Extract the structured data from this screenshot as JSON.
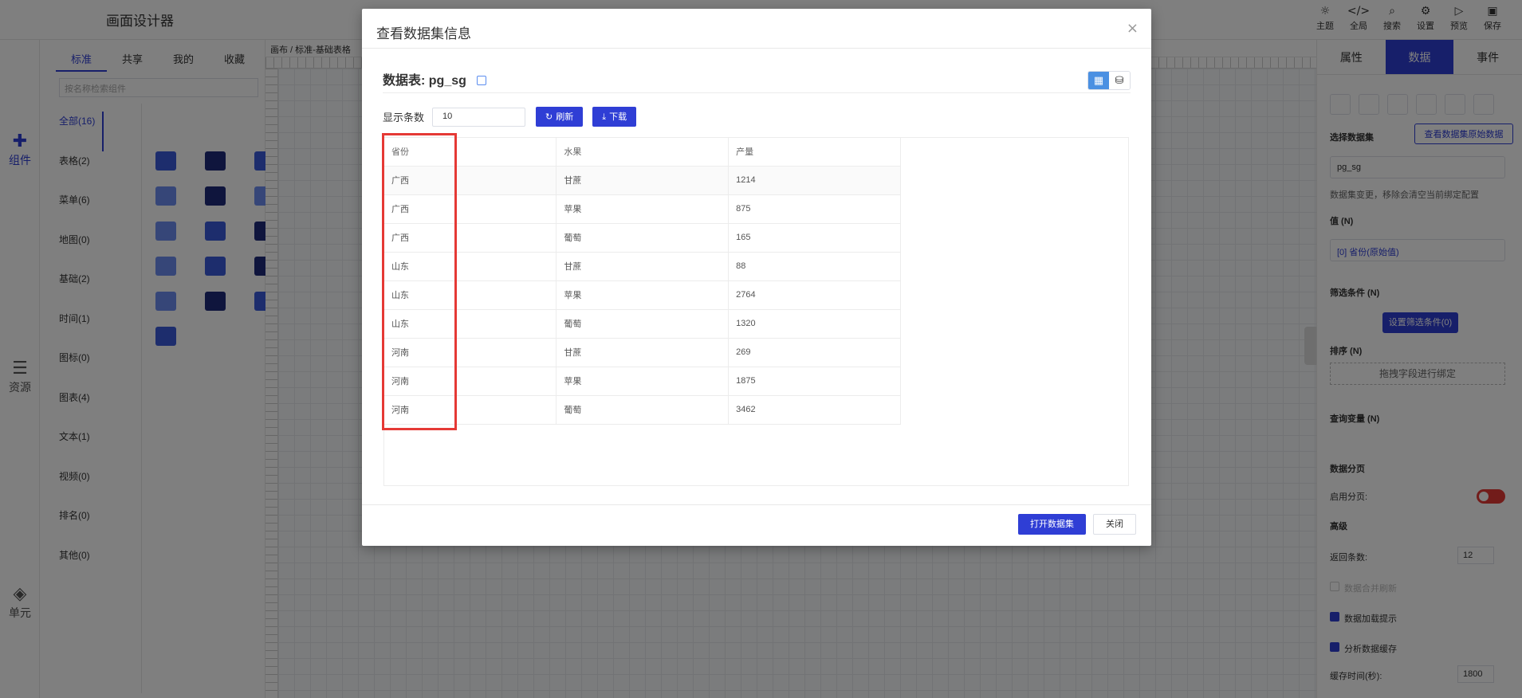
{
  "app": {
    "title": "画面设计器",
    "top_actions": [
      {
        "icon": "theme-icon",
        "glyph": "☼",
        "label": "主题"
      },
      {
        "icon": "code-icon",
        "glyph": "</>",
        "label": "全局"
      },
      {
        "icon": "search-icon",
        "glyph": "⌕",
        "label": "搜索"
      },
      {
        "icon": "gear-icon",
        "glyph": "⚙",
        "label": "设置"
      },
      {
        "icon": "play-icon",
        "glyph": "▷",
        "label": "预览"
      },
      {
        "icon": "save-icon",
        "glyph": "▣",
        "label": "保存"
      }
    ]
  },
  "left_rail": {
    "items": [
      {
        "icon": "puzzle-icon",
        "glyph": "✚",
        "label": "组件"
      },
      {
        "icon": "list-icon",
        "glyph": "☰",
        "label": "资源"
      },
      {
        "icon": "layers-icon",
        "glyph": "◈",
        "label": "单元"
      }
    ]
  },
  "components": {
    "tabs": [
      "标准",
      "共享",
      "我的",
      "收藏"
    ],
    "search_placeholder": "按名称检索组件",
    "categories": [
      "全部(16)",
      "表格(2)",
      "菜单(6)",
      "地图(0)",
      "基础(2)",
      "时间(1)",
      "图标(0)",
      "图表(4)",
      "文本(1)",
      "视频(0)",
      "排名(0)",
      "其他(0)"
    ]
  },
  "canvas": {
    "crumb": "画布 / 标准-基础表格"
  },
  "right_panel": {
    "tabs": [
      "属性",
      "数据",
      "事件"
    ],
    "select_dataset_label": "选择数据集",
    "view_raw_button": "查看数据集原始数据",
    "dataset_value": "pg_sg",
    "dataset_warning": "数据集变更，移除会清空当前绑定配置",
    "value_label": "值 (N)",
    "value_select": "[0] 省份(原始值)",
    "filter_label": "筛选条件 (N)",
    "filter_button": "设置筛选条件(0)",
    "sort_label": "排序 (N)",
    "sort_drop": "拖拽字段进行绑定",
    "query_var_label": "查询变量 (N)",
    "paging_label": "数据分页",
    "enable_paging": "启用分页:",
    "advanced_label": "高级",
    "return_count_label": "返回条数:",
    "return_count_value": "12",
    "data_merge_label": "数据合并刷新",
    "loading_hint_label": "数据加载提示",
    "analysis_cache_label": "分析数据缓存",
    "cache_time_label": "缓存时间(秒):",
    "cache_time_value": "1800"
  },
  "modal": {
    "title": "查看数据集信息",
    "dataset_title": "数据表: pg_sg",
    "display_count_label": "显示条数",
    "display_count_value": "10",
    "refresh_button": "刷新",
    "download_button": "下载",
    "table": {
      "columns": [
        "省份",
        "水果",
        "产量"
      ],
      "rows": [
        [
          "广西",
          "甘蔗",
          "1214"
        ],
        [
          "广西",
          "苹果",
          "875"
        ],
        [
          "广西",
          "葡萄",
          "165"
        ],
        [
          "山东",
          "甘蔗",
          "88"
        ],
        [
          "山东",
          "苹果",
          "2764"
        ],
        [
          "山东",
          "葡萄",
          "1320"
        ],
        [
          "河南",
          "甘蔗",
          "269"
        ],
        [
          "河南",
          "苹果",
          "1875"
        ],
        [
          "河南",
          "葡萄",
          "3462"
        ]
      ]
    },
    "open_dataset_button": "打开数据集",
    "close_button": "关闭"
  },
  "colors": {
    "primary": "#2f3ed5",
    "highlight_box": "#e53935"
  }
}
